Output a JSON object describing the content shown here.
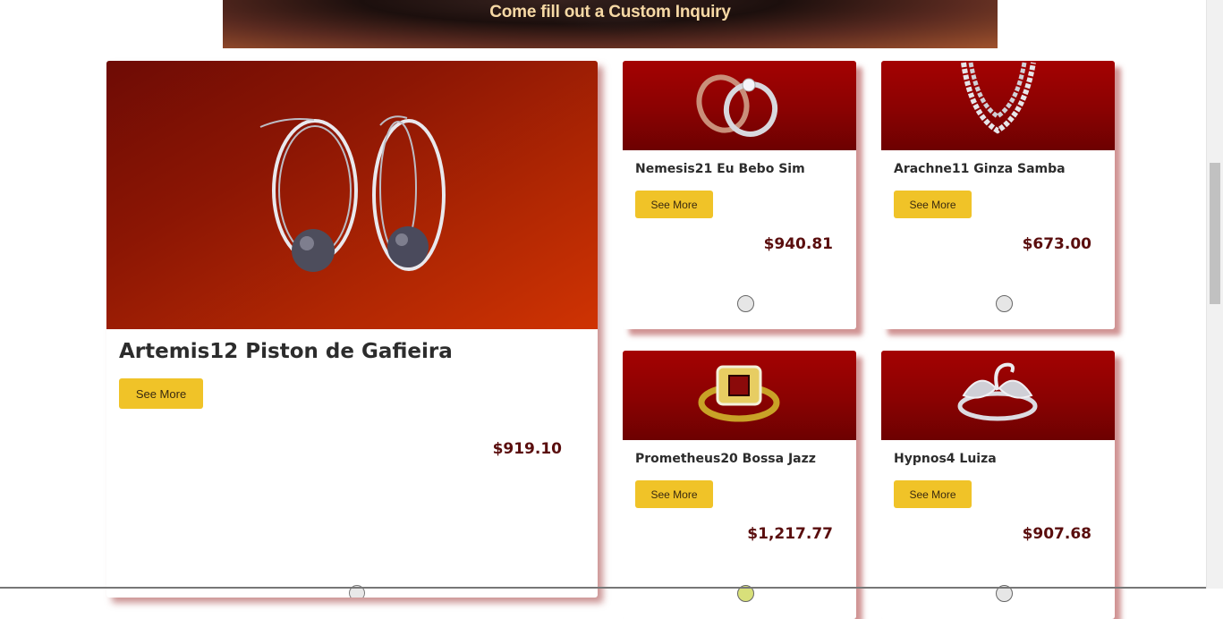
{
  "banner": {
    "text": "Come fill out a Custom Inquiry"
  },
  "featured": {
    "title": "Artemis12 Piston de Gafieira",
    "button_label": "See More",
    "price": "$919.10",
    "image_icon": "pearl-hoop-earrings-image"
  },
  "cards": [
    {
      "name": "Nemesis21 Eu Bebo Sim",
      "button_label": "See More",
      "price": "$940.81",
      "image_icon": "wedding-rings-image"
    },
    {
      "name": "Arachne11 Ginza Samba",
      "button_label": "See More",
      "price": "$673.00",
      "image_icon": "silver-chain-necklace-image"
    },
    {
      "name": "Prometheus20 Bossa Jazz",
      "button_label": "See More",
      "price": "$1,217.77",
      "image_icon": "gold-ruby-ring-image"
    },
    {
      "name": "Hypnos4 Luiza",
      "button_label": "See More",
      "price": "$907.68",
      "image_icon": "silver-swan-ring-image"
    }
  ],
  "colors": {
    "accent_button": "#f0c328",
    "price_text": "#5a0e0e",
    "card_header": "#a40202"
  }
}
